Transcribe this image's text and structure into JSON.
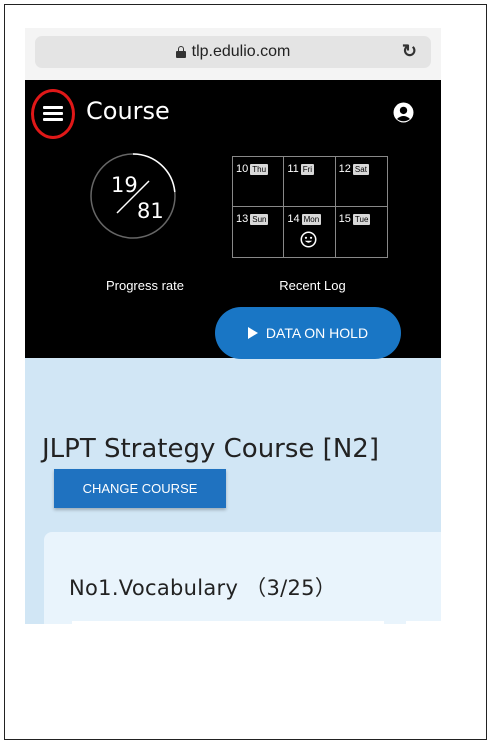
{
  "browser": {
    "url": "tlp.edulio.com",
    "reload_icon": "reload-icon",
    "lock_icon": "lock-icon"
  },
  "header": {
    "title": "Course",
    "menu_icon": "hamburger-menu-icon",
    "user_icon": "user-account-icon"
  },
  "progress": {
    "done": "19",
    "total": "81",
    "label": "Progress rate",
    "fraction": 0.235
  },
  "recent_log": {
    "label": "Recent Log",
    "days": [
      {
        "date": "10",
        "day": "Thu",
        "mark": ""
      },
      {
        "date": "11",
        "day": "Fri",
        "mark": ""
      },
      {
        "date": "12",
        "day": "Sat",
        "mark": ""
      },
      {
        "date": "13",
        "day": "Sun",
        "mark": ""
      },
      {
        "date": "14",
        "day": "Mon",
        "mark": "smiley-icon"
      },
      {
        "date": "15",
        "day": "Tue",
        "mark": ""
      }
    ]
  },
  "hold_button": {
    "label": "DATA ON HOLD"
  },
  "course": {
    "name": "JLPT Strategy Course [N2]",
    "change_label": "CHANGE COURSE"
  },
  "section": {
    "title": "No1.Vocabulary （3/25）"
  },
  "colors": {
    "accent": "#1976c5",
    "header_bg": "#000000",
    "content_bg": "#d1e6f5",
    "highlight_ring": "#e01818"
  }
}
